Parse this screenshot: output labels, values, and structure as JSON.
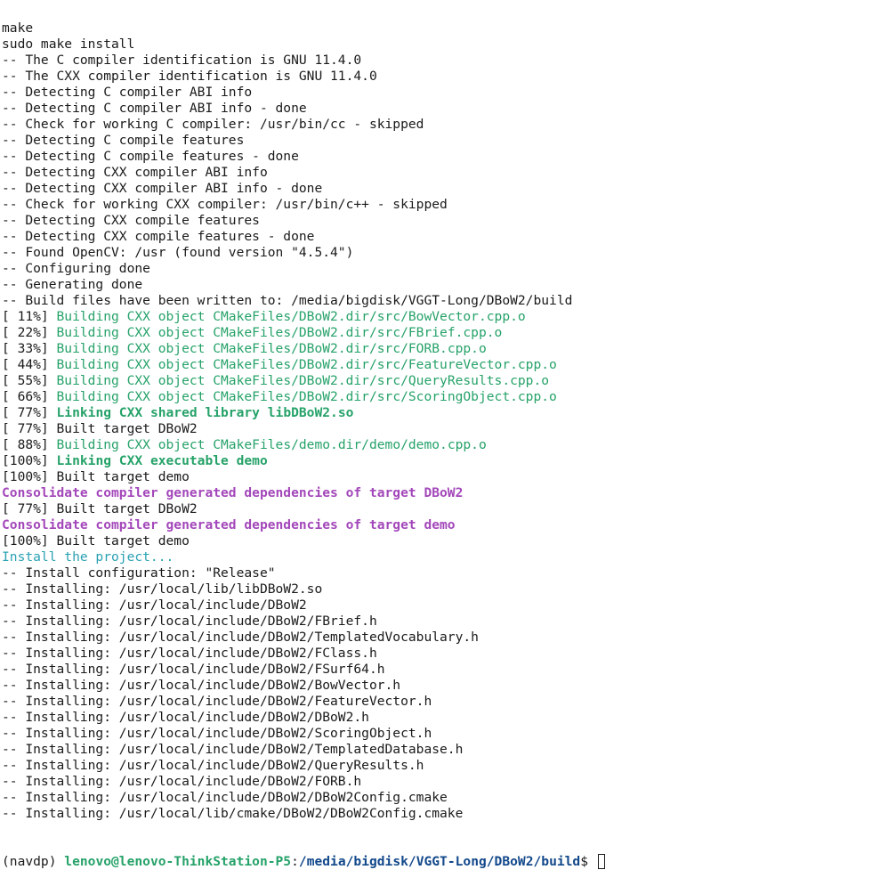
{
  "terminal": {
    "lines": [
      {
        "segments": [
          {
            "text": "make",
            "style": ""
          }
        ]
      },
      {
        "segments": [
          {
            "text": "sudo make install",
            "style": ""
          }
        ]
      },
      {
        "segments": [
          {
            "text": "-- The C compiler identification is GNU 11.4.0",
            "style": ""
          }
        ]
      },
      {
        "segments": [
          {
            "text": "-- The CXX compiler identification is GNU 11.4.0",
            "style": ""
          }
        ]
      },
      {
        "segments": [
          {
            "text": "-- Detecting C compiler ABI info",
            "style": ""
          }
        ]
      },
      {
        "segments": [
          {
            "text": "-- Detecting C compiler ABI info - done",
            "style": ""
          }
        ]
      },
      {
        "segments": [
          {
            "text": "-- Check for working C compiler: /usr/bin/cc - skipped",
            "style": ""
          }
        ]
      },
      {
        "segments": [
          {
            "text": "-- Detecting C compile features",
            "style": ""
          }
        ]
      },
      {
        "segments": [
          {
            "text": "-- Detecting C compile features - done",
            "style": ""
          }
        ]
      },
      {
        "segments": [
          {
            "text": "-- Detecting CXX compiler ABI info",
            "style": ""
          }
        ]
      },
      {
        "segments": [
          {
            "text": "-- Detecting CXX compiler ABI info - done",
            "style": ""
          }
        ]
      },
      {
        "segments": [
          {
            "text": "-- Check for working CXX compiler: /usr/bin/c++ - skipped",
            "style": ""
          }
        ]
      },
      {
        "segments": [
          {
            "text": "-- Detecting CXX compile features",
            "style": ""
          }
        ]
      },
      {
        "segments": [
          {
            "text": "-- Detecting CXX compile features - done",
            "style": ""
          }
        ]
      },
      {
        "segments": [
          {
            "text": "-- Found OpenCV: /usr (found version \"4.5.4\")",
            "style": ""
          }
        ]
      },
      {
        "segments": [
          {
            "text": "-- Configuring done",
            "style": ""
          }
        ]
      },
      {
        "segments": [
          {
            "text": "-- Generating done",
            "style": ""
          }
        ]
      },
      {
        "segments": [
          {
            "text": "-- Build files have been written to: /media/bigdisk/VGGT-Long/DBoW2/build",
            "style": ""
          }
        ]
      },
      {
        "segments": [
          {
            "text": "[ 11%] ",
            "style": ""
          },
          {
            "text": "Building CXX object CMakeFiles/DBoW2.dir/src/BowVector.cpp.o",
            "style": "green"
          }
        ]
      },
      {
        "segments": [
          {
            "text": "[ 22%] ",
            "style": ""
          },
          {
            "text": "Building CXX object CMakeFiles/DBoW2.dir/src/FBrief.cpp.o",
            "style": "green"
          }
        ]
      },
      {
        "segments": [
          {
            "text": "[ 33%] ",
            "style": ""
          },
          {
            "text": "Building CXX object CMakeFiles/DBoW2.dir/src/FORB.cpp.o",
            "style": "green"
          }
        ]
      },
      {
        "segments": [
          {
            "text": "[ 44%] ",
            "style": ""
          },
          {
            "text": "Building CXX object CMakeFiles/DBoW2.dir/src/FeatureVector.cpp.o",
            "style": "green"
          }
        ]
      },
      {
        "segments": [
          {
            "text": "[ 55%] ",
            "style": ""
          },
          {
            "text": "Building CXX object CMakeFiles/DBoW2.dir/src/QueryResults.cpp.o",
            "style": "green"
          }
        ]
      },
      {
        "segments": [
          {
            "text": "[ 66%] ",
            "style": ""
          },
          {
            "text": "Building CXX object CMakeFiles/DBoW2.dir/src/ScoringObject.cpp.o",
            "style": "green"
          }
        ]
      },
      {
        "segments": [
          {
            "text": "[ 77%] ",
            "style": ""
          },
          {
            "text": "Linking CXX shared library libDBoW2.so",
            "style": "green-bold"
          }
        ]
      },
      {
        "segments": [
          {
            "text": "[ 77%] Built target DBoW2",
            "style": ""
          }
        ]
      },
      {
        "segments": [
          {
            "text": "[ 88%] ",
            "style": ""
          },
          {
            "text": "Building CXX object CMakeFiles/demo.dir/demo/demo.cpp.o",
            "style": "green"
          }
        ]
      },
      {
        "segments": [
          {
            "text": "[100%] ",
            "style": ""
          },
          {
            "text": "Linking CXX executable demo",
            "style": "green-bold"
          }
        ]
      },
      {
        "segments": [
          {
            "text": "[100%] Built target demo",
            "style": ""
          }
        ]
      },
      {
        "segments": [
          {
            "text": "Consolidate compiler generated dependencies of target DBoW2",
            "style": "magenta-bold"
          }
        ]
      },
      {
        "segments": [
          {
            "text": "[ 77%] Built target DBoW2",
            "style": ""
          }
        ]
      },
      {
        "segments": [
          {
            "text": "Consolidate compiler generated dependencies of target demo",
            "style": "magenta-bold"
          }
        ]
      },
      {
        "segments": [
          {
            "text": "[100%] Built target demo",
            "style": ""
          }
        ]
      },
      {
        "segments": [
          {
            "text": "Install the project...",
            "style": "cyan"
          }
        ]
      },
      {
        "segments": [
          {
            "text": "-- Install configuration: \"Release\"",
            "style": ""
          }
        ]
      },
      {
        "segments": [
          {
            "text": "-- Installing: /usr/local/lib/libDBoW2.so",
            "style": ""
          }
        ]
      },
      {
        "segments": [
          {
            "text": "-- Installing: /usr/local/include/DBoW2",
            "style": ""
          }
        ]
      },
      {
        "segments": [
          {
            "text": "-- Installing: /usr/local/include/DBoW2/FBrief.h",
            "style": ""
          }
        ]
      },
      {
        "segments": [
          {
            "text": "-- Installing: /usr/local/include/DBoW2/TemplatedVocabulary.h",
            "style": ""
          }
        ]
      },
      {
        "segments": [
          {
            "text": "-- Installing: /usr/local/include/DBoW2/FClass.h",
            "style": ""
          }
        ]
      },
      {
        "segments": [
          {
            "text": "-- Installing: /usr/local/include/DBoW2/FSurf64.h",
            "style": ""
          }
        ]
      },
      {
        "segments": [
          {
            "text": "-- Installing: /usr/local/include/DBoW2/BowVector.h",
            "style": ""
          }
        ]
      },
      {
        "segments": [
          {
            "text": "-- Installing: /usr/local/include/DBoW2/FeatureVector.h",
            "style": ""
          }
        ]
      },
      {
        "segments": [
          {
            "text": "-- Installing: /usr/local/include/DBoW2/DBoW2.h",
            "style": ""
          }
        ]
      },
      {
        "segments": [
          {
            "text": "-- Installing: /usr/local/include/DBoW2/ScoringObject.h",
            "style": ""
          }
        ]
      },
      {
        "segments": [
          {
            "text": "-- Installing: /usr/local/include/DBoW2/TemplatedDatabase.h",
            "style": ""
          }
        ]
      },
      {
        "segments": [
          {
            "text": "-- Installing: /usr/local/include/DBoW2/QueryResults.h",
            "style": ""
          }
        ]
      },
      {
        "segments": [
          {
            "text": "-- Installing: /usr/local/include/DBoW2/FORB.h",
            "style": ""
          }
        ]
      },
      {
        "segments": [
          {
            "text": "-- Installing: /usr/local/include/DBoW2/DBoW2Config.cmake",
            "style": ""
          }
        ]
      },
      {
        "segments": [
          {
            "text": "-- Installing: /usr/local/lib/cmake/DBoW2/DBoW2Config.cmake",
            "style": ""
          }
        ]
      }
    ],
    "prompt": {
      "env": "(navdp) ",
      "user_host": "lenovo@lenovo-ThinkStation-P5",
      "separator": ":",
      "path": "/media/bigdisk/VGGT-Long/DBoW2/build",
      "symbol": "$ "
    },
    "colors": {
      "background": "#ffffff",
      "foreground": "#1a1a1a",
      "green": "#26a269",
      "magenta": "#a347ba",
      "cyan": "#2aa1b3",
      "blue": "#12488b"
    }
  }
}
